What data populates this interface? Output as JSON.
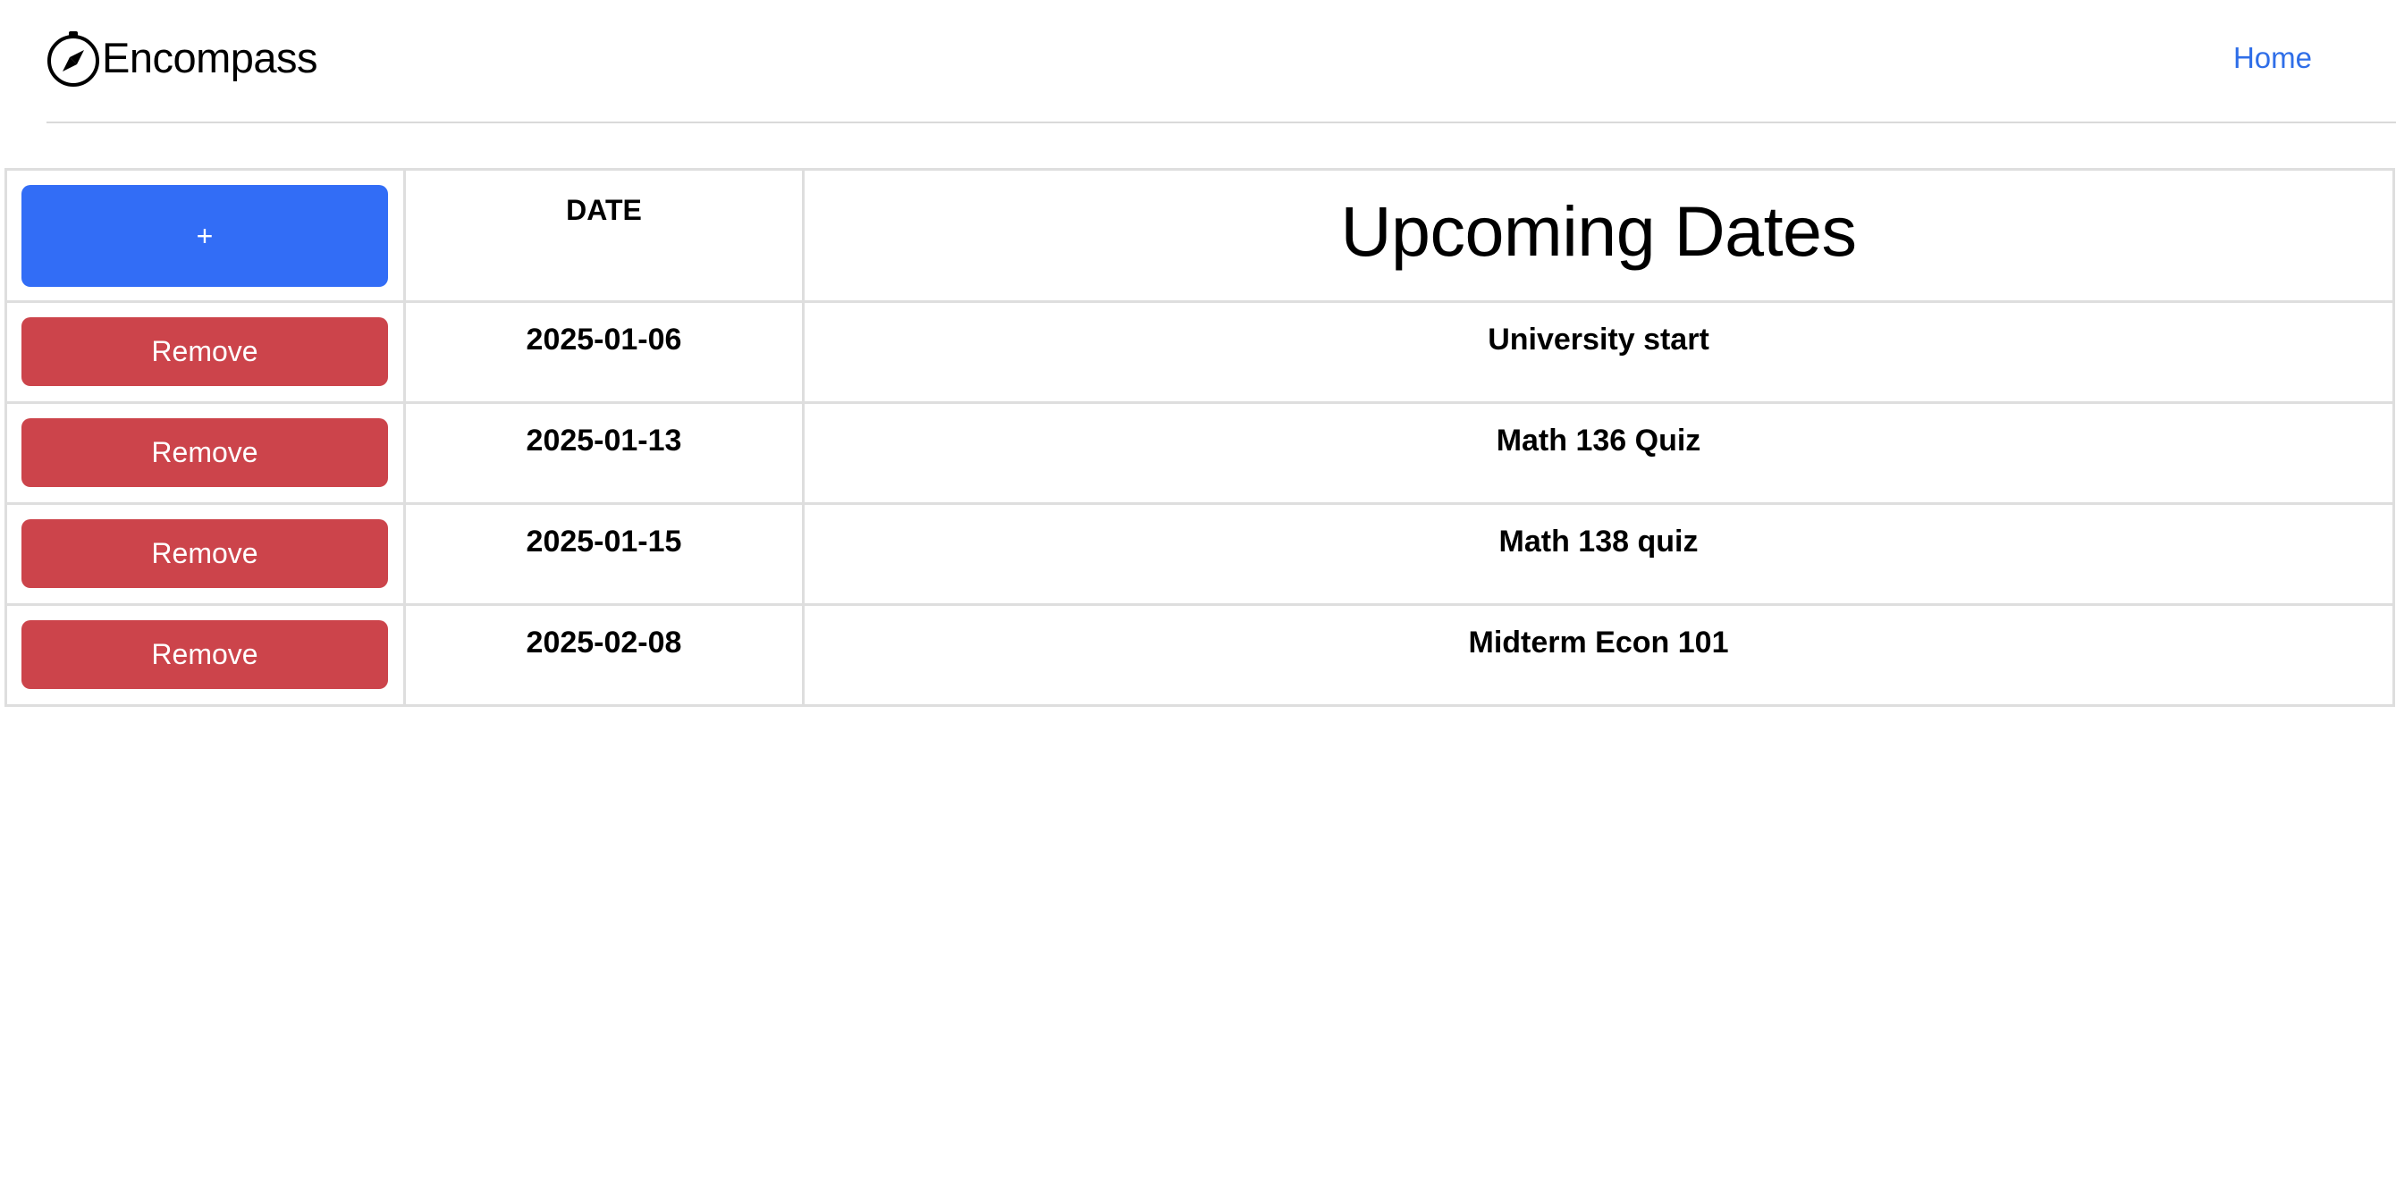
{
  "nav": {
    "brand": "Encompass",
    "brand_icon": "compass-icon",
    "home_link": "Home",
    "link_color": "#2f6ee8"
  },
  "table": {
    "add_label": "+",
    "date_header": "DATE",
    "title": "Upcoming Dates",
    "add_color": "#326df6",
    "remove_color": "#cc444b",
    "rows": [
      {
        "action": "Remove",
        "date": "2025-01-06",
        "event": "University start"
      },
      {
        "action": "Remove",
        "date": "2025-01-13",
        "event": "Math 136 Quiz"
      },
      {
        "action": "Remove",
        "date": "2025-01-15",
        "event": "Math 138 quiz"
      },
      {
        "action": "Remove",
        "date": "2025-02-08",
        "event": "Midterm Econ 101"
      }
    ]
  }
}
